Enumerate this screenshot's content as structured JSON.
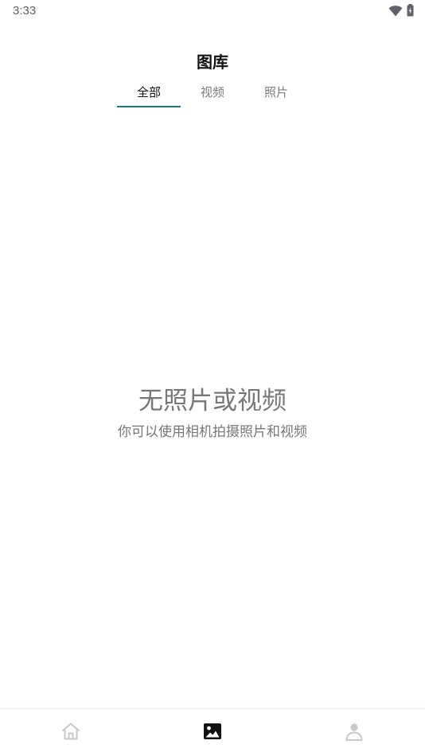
{
  "status_bar": {
    "time": "3:33"
  },
  "header": {
    "title": "图库"
  },
  "tabs": [
    {
      "label": "全部",
      "active": true
    },
    {
      "label": "视频",
      "active": false
    },
    {
      "label": "照片",
      "active": false
    }
  ],
  "empty_state": {
    "title": "无照片或视频",
    "subtitle": "你可以使用相机拍摄照片和视频"
  },
  "bottom_nav": [
    {
      "icon": "home-icon",
      "active": false
    },
    {
      "icon": "gallery-icon",
      "active": true
    },
    {
      "icon": "profile-icon",
      "active": false
    }
  ],
  "colors": {
    "accent": "#127c82",
    "inactive_icon": "#c8c8c8",
    "active_icon": "#111111",
    "muted_text": "#777777"
  }
}
